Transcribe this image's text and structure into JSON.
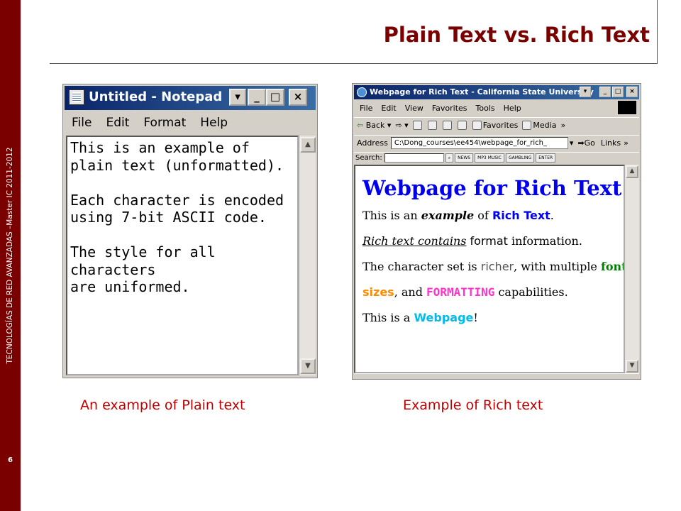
{
  "sidebar": {
    "vertical_text": "TECNOLOGÍAS DE RED AVANZADAS –Master IC 2011-2012",
    "page_number": "6"
  },
  "slide": {
    "title": "Plain Text vs. Rich Text"
  },
  "notepad": {
    "window_title": "Untitled - Notepad",
    "menu": [
      "File",
      "Edit",
      "Format",
      "Help"
    ],
    "content": "This is an example of\nplain text (unformatted).\n\nEach character is encoded\nusing 7-bit ASCII code.\n\nThe style for all\ncharacters\nare uniformed."
  },
  "browser": {
    "window_title": "Webpage for Rich Text - California State University",
    "menu": [
      "File",
      "Edit",
      "View",
      "Favorites",
      "Tools",
      "Help"
    ],
    "toolbar": {
      "back": "Back",
      "favorites": "Favorites",
      "media": "Media"
    },
    "address_label": "Address",
    "address_value": "C:\\Dong_courses\\ee454\\webpage_for_rich_",
    "go_label": "Go",
    "links_label": "Links",
    "search_label": "Search:",
    "search_buttons": [
      "NEWS",
      "MP3 MUSIC",
      "GAMBLING",
      "ENTER"
    ],
    "page": {
      "heading": "Webpage for Rich Text",
      "line1_a": "This is an ",
      "line1_b": "example",
      "line1_c": " of ",
      "line1_d": "Rich Text",
      "line1_e": ".",
      "line2_a": "Rich text contains",
      "line2_b": " format",
      "line2_c": " information.",
      "line3_a": "The character set is ",
      "line3_b": "richer",
      "line3_c": ", with multiple ",
      "line3_d": "fonts",
      "line3_e": ",",
      "line4_a": "sizes",
      "line4_b": ", and ",
      "line4_c": "FORMATTING",
      "line4_d": " capabilities.",
      "line5_a": "This is a ",
      "line5_b": "Webpage",
      "line5_c": "!"
    }
  },
  "captions": {
    "left": "An example of Plain text",
    "right": "Example of Rich text"
  },
  "colors": {
    "sidebar": "#7a0000",
    "title": "#7a0000",
    "caption": "#c00000"
  }
}
